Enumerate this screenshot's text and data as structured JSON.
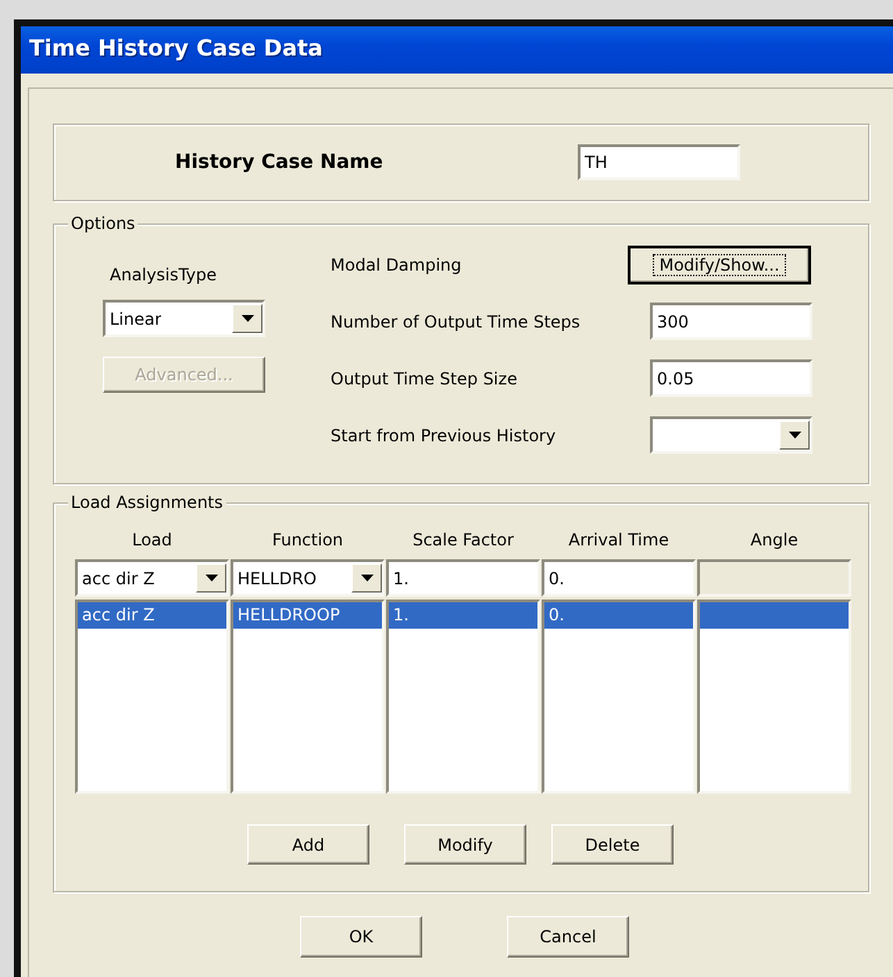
{
  "window": {
    "title": "Time History Case Data"
  },
  "history_case_name": {
    "label": "History Case Name",
    "value": "TH"
  },
  "options": {
    "title": "Options",
    "analysis_type": {
      "label": "AnalysisType",
      "value": "Linear"
    },
    "advanced_button": {
      "label": "Advanced...",
      "disabled": true
    },
    "rows": [
      {
        "kind": "button",
        "label": "Modal Damping",
        "button": "Modify/Show...",
        "focused": true
      },
      {
        "kind": "text",
        "label": "Number of Output Time Steps",
        "value": "300"
      },
      {
        "kind": "text",
        "label": "Output Time Step Size",
        "value": "0.05"
      },
      {
        "kind": "dropdown",
        "label": "Start from Previous History"
      }
    ]
  },
  "load_assignments": {
    "title": "Load Assignments",
    "columns": [
      "Load",
      "Function",
      "Scale Factor",
      "Arrival Time",
      "Angle"
    ],
    "edit_row": [
      {
        "kind": "dropdown",
        "value": "acc dir Z"
      },
      {
        "kind": "dropdown",
        "value": "HELLDRO"
      },
      {
        "kind": "text",
        "value": "1."
      },
      {
        "kind": "text",
        "value": "0."
      },
      {
        "kind": "text",
        "disabled": true
      }
    ],
    "rows": [
      {
        "selected": true,
        "cells": [
          "acc dir Z",
          "HELLDROOP",
          "1.",
          "0."
        ]
      }
    ],
    "buttons": [
      "Add",
      "Modify",
      "Delete"
    ]
  },
  "dialog_buttons": [
    "OK",
    "Cancel"
  ]
}
